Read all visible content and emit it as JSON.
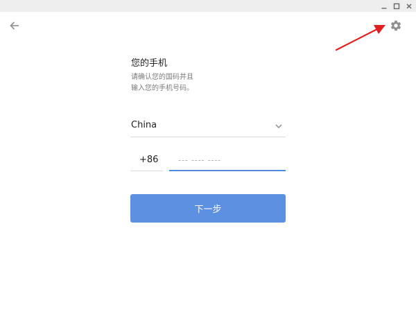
{
  "window_controls": {
    "minimize_icon": "minimize-icon",
    "maximize_icon": "maximize-icon",
    "close_icon": "close-icon"
  },
  "header": {
    "back_icon": "arrow-left-icon",
    "settings_icon": "gear-icon"
  },
  "form": {
    "title": "您的手机",
    "subtitle_line1": "请确认您的国码并且",
    "subtitle_line2": "输入您的手机号码。",
    "country": "China",
    "country_code": "+86",
    "phone_value": "",
    "phone_placeholder": "--- ---- ----",
    "next_label": "下一步"
  },
  "colors": {
    "accent": "#5b91e0",
    "input_focus": "#4d8ae0",
    "annotation_arrow": "#e02020",
    "titlebar": "#eeeeee"
  }
}
